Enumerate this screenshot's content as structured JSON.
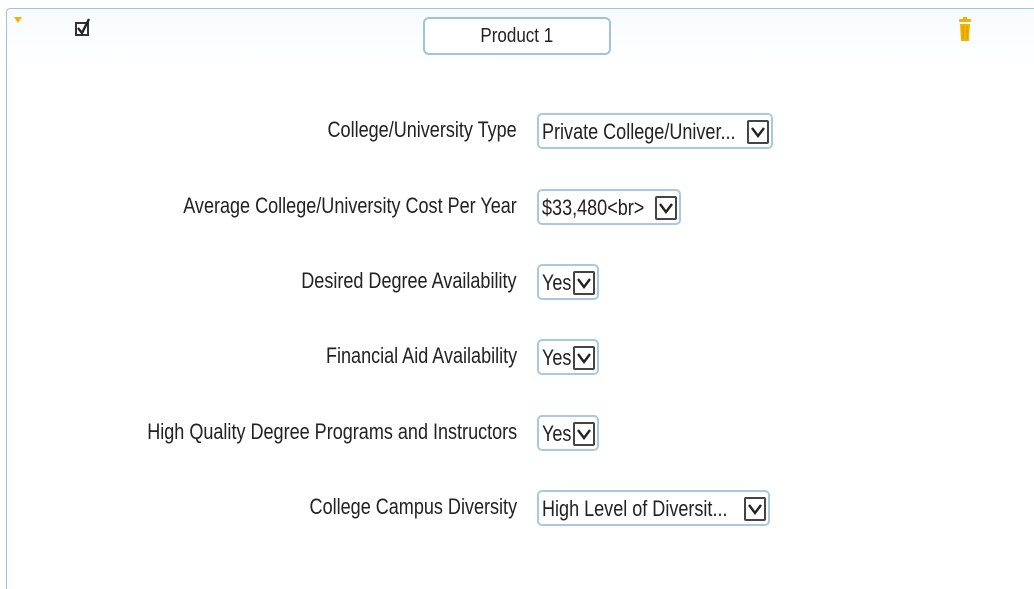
{
  "product": {
    "title": "Product 1",
    "checked": true
  },
  "fields": [
    {
      "label": "College/University Type",
      "value": "Private College/Univer..."
    },
    {
      "label": "Average College/University Cost Per Year",
      "value": "$33,480<br>"
    },
    {
      "label": "Desired Degree Availability",
      "value": "Yes"
    },
    {
      "label": "Financial Aid Availability",
      "value": "Yes"
    },
    {
      "label": "High Quality Degree Programs and Instructors",
      "value": "Yes"
    },
    {
      "label": "College Campus Diversity",
      "value": "High Level of Diversit..."
    }
  ],
  "colors": {
    "accent": "#f0b400",
    "border": "#9ec3de"
  },
  "icons": {
    "collapse": "triangle-down-icon",
    "delete": "trash-icon",
    "dropdown": "chevron-down-icon"
  }
}
